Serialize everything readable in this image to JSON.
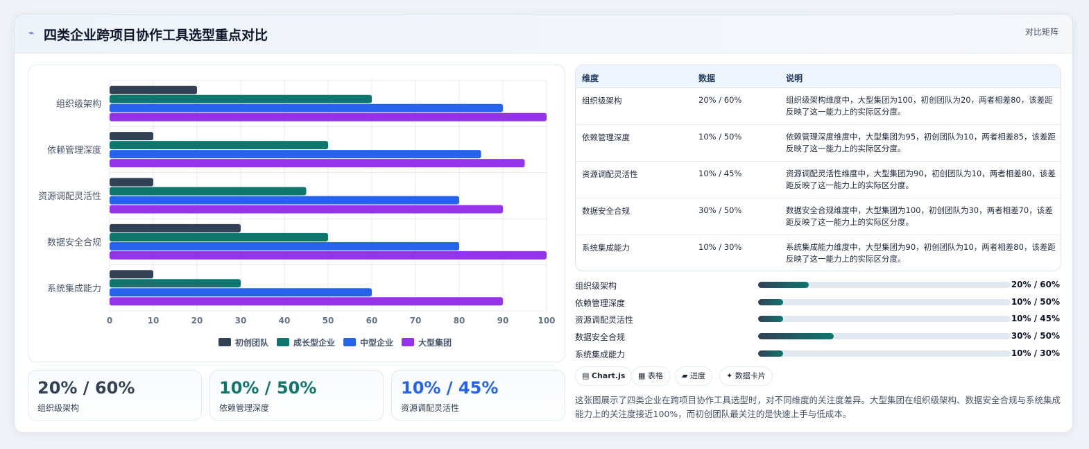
{
  "header": {
    "icon": "chart-icon",
    "title": "四类企业跨项目协作工具选型重点对比",
    "right": "对比矩阵"
  },
  "chart_data": {
    "type": "bar",
    "orientation": "horizontal",
    "categories": [
      "组织级架构",
      "依赖管理深度",
      "资源调配灵活性",
      "数据安全合规",
      "系统集成能力"
    ],
    "series": [
      {
        "name": "初创团队",
        "color": "#334155",
        "values": [
          20,
          10,
          10,
          30,
          10
        ]
      },
      {
        "name": "成长型企业",
        "color": "#0f766e",
        "values": [
          60,
          50,
          45,
          50,
          30
        ]
      },
      {
        "name": "中型企业",
        "color": "#2563eb",
        "values": [
          90,
          85,
          80,
          80,
          60
        ]
      },
      {
        "name": "大型集团",
        "color": "#9333ea",
        "values": [
          100,
          95,
          90,
          100,
          90
        ]
      }
    ],
    "xlim": [
      0,
      100
    ],
    "xticks": [
      "0",
      "10",
      "20",
      "30",
      "40",
      "50",
      "60",
      "70",
      "80",
      "90",
      "100"
    ],
    "grid": true,
    "legend": "bottom"
  },
  "stats": [
    {
      "value": "20% / 60%",
      "label": "组织级架构",
      "color": "#334155"
    },
    {
      "value": "10% / 50%",
      "label": "依赖管理深度",
      "color": "#0f766e"
    },
    {
      "value": "10% / 45%",
      "label": "资源调配灵活性",
      "color": "#2563eb"
    }
  ],
  "table": {
    "headers": [
      "维度",
      "数据",
      "说明"
    ],
    "rows": [
      {
        "dim": "组织级架构",
        "data": "20% / 60%",
        "note": "组织级架构维度中，大型集团为100，初创团队为20，两者相差80，该差距反映了这一能力上的实际区分度。"
      },
      {
        "dim": "依赖管理深度",
        "data": "10% / 50%",
        "note": "依赖管理深度维度中，大型集团为95，初创团队为10，两者相差85，该差距反映了这一能力上的实际区分度。"
      },
      {
        "dim": "资源调配灵活性",
        "data": "10% / 45%",
        "note": "资源调配灵活性维度中，大型集团为90，初创团队为10，两者相差80，该差距反映了这一能力上的实际区分度。"
      },
      {
        "dim": "数据安全合规",
        "data": "30% / 50%",
        "note": "数据安全合规维度中，大型集团为100，初创团队为30，两者相差70，该差距反映了这一能力上的实际区分度。"
      },
      {
        "dim": "系统集成能力",
        "data": "10% / 30%",
        "note": "系统集成能力维度中，大型集团为90，初创团队为10，两者相差80，该差距反映了这一能力上的实际区分度。"
      }
    ]
  },
  "progress": [
    {
      "label": "组织级架构",
      "fraction": 0.2,
      "text": "20% / 60%"
    },
    {
      "label": "依赖管理深度",
      "fraction": 0.1,
      "text": "10% / 50%"
    },
    {
      "label": "资源调配灵活性",
      "fraction": 0.1,
      "text": "10% / 45%"
    },
    {
      "label": "数据安全合规",
      "fraction": 0.3,
      "text": "30% / 50%"
    },
    {
      "label": "系统集成能力",
      "fraction": 0.1,
      "text": "10% / 30%"
    }
  ],
  "tags": [
    {
      "icon": "chart-icon",
      "label": "Chart.js"
    },
    {
      "icon": "table-icon",
      "label": "表格"
    },
    {
      "icon": "progress-icon",
      "label": "进度"
    },
    {
      "icon": "sparkle-icon",
      "label": "数据卡片"
    }
  ],
  "description": "这张图展示了四类企业在跨项目协作工具选型时，对不同维度的关注度差异。大型集团在组织级架构、数据安全合规与系统集成能力上的关注度接近100%，而初创团队最关注的是快速上手与低成本。"
}
